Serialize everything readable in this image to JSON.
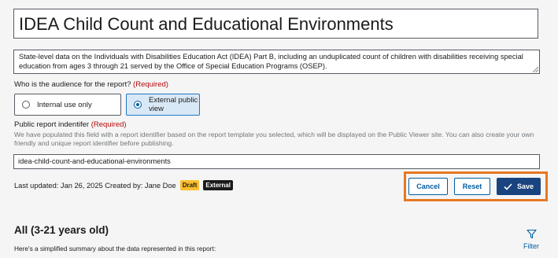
{
  "report": {
    "title": "IDEA Child Count and Educational Environments",
    "description": "State-level data on the Individuals with Disabilities Education Act (IDEA) Part B, including an unduplicated count of children with disabilities receiving special education from ages 3 through 21 served by the Office of Special Education Programs (OSEP)."
  },
  "audience": {
    "label": "Who is the audience for the report?",
    "required": "(Required)",
    "options": [
      {
        "label": "Internal use only",
        "selected": false
      },
      {
        "label": "External public view",
        "selected": true
      }
    ]
  },
  "identifier": {
    "label": "Public report indentifer",
    "required": "(Required)",
    "hint": "We have populated this field with a report identifier based on the report template you selected, which will be displayed on the Public Viewer site. You can also create your own friendly and unique report identifier before publishing.",
    "value": "idea-child-count-and-educational-environments"
  },
  "meta": {
    "updated": "Last updated: Jan 26, 2025 Created by: Jane Doe",
    "badges": [
      "Draft",
      "External"
    ]
  },
  "actions": {
    "cancel": "Cancel",
    "reset": "Reset",
    "save": "Save"
  },
  "section": {
    "title": "All (3-21 years old)",
    "subtitle": "Here's a simplified summary about the data represented in this report:",
    "filter_label": "Filter"
  },
  "colors": {
    "primary": "#005ea2",
    "save_bg": "#1a4480",
    "selected_bg": "#d9e8f6",
    "required": "#b50909",
    "draft_badge": "#ffbe2e",
    "external_badge": "#1b1b1b",
    "highlight_frame": "#e87722"
  },
  "icons": {
    "save": "check-icon",
    "filter": "filter-funnel-icon"
  }
}
